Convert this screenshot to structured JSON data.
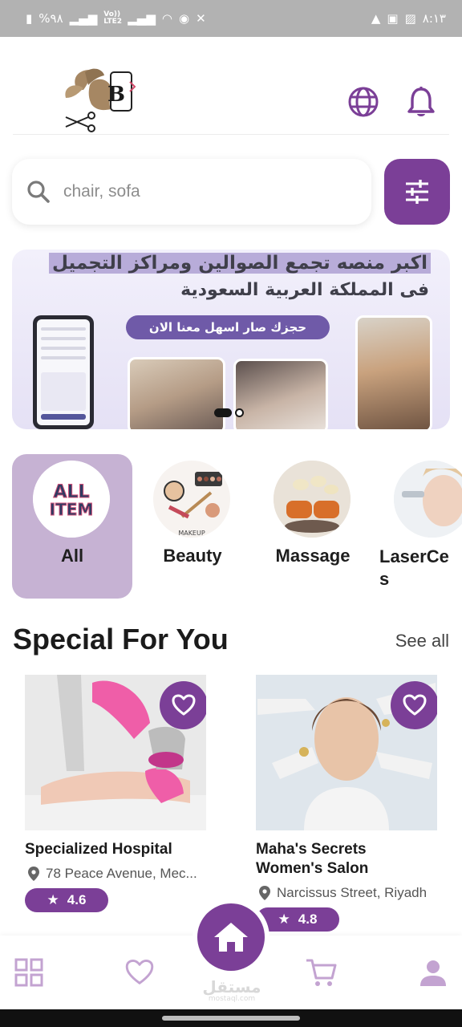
{
  "status_bar": {
    "battery": "%٩٨",
    "network": "Vo)) LTE2",
    "time": "٨:١٣"
  },
  "header": {
    "logo_alt": "B beauty logo",
    "logo_letter": "B",
    "globe_icon": "globe-icon",
    "bell_icon": "bell-icon"
  },
  "search": {
    "placeholder": "chair, sofa",
    "icon": "search-icon",
    "filter_icon": "sliders-icon"
  },
  "banner": {
    "line1": "اكبر منصه تجمع الصوالين ومراكز التجميل",
    "line2": "فى المملكة العربية السعودية",
    "pill": "حجزك صار اسهل معنا الان",
    "page": 1,
    "pages": 2
  },
  "categories": [
    {
      "label": "All",
      "image_text": "ALL ITEM",
      "active": true
    },
    {
      "label": "Beauty",
      "image_text": "MAKEUP",
      "active": false
    },
    {
      "label": "Massage",
      "image_text": "",
      "active": false
    },
    {
      "label": "LaserCe s",
      "image_text": "",
      "active": false
    }
  ],
  "section": {
    "title": "Special For You",
    "see_all": "See all"
  },
  "cards": [
    {
      "name": "Specialized Hospital",
      "location": "78 Peace Avenue, Mec...",
      "rating": "4.6"
    },
    {
      "name": "Maha's Secrets Women's Salon",
      "location": "Narcissus Street, Riyadh",
      "rating": "4.8"
    }
  ],
  "bottom_nav": {
    "items": [
      "grid-icon",
      "heart-icon",
      "home-icon",
      "cart-icon",
      "profile-icon"
    ]
  },
  "watermark": {
    "arabic": "مستقل",
    "latin": "mostaql.com"
  },
  "colors": {
    "brand": "#7b3f97",
    "category_active": "#c6b2d3",
    "nav_icon": "#c3a3d1"
  }
}
